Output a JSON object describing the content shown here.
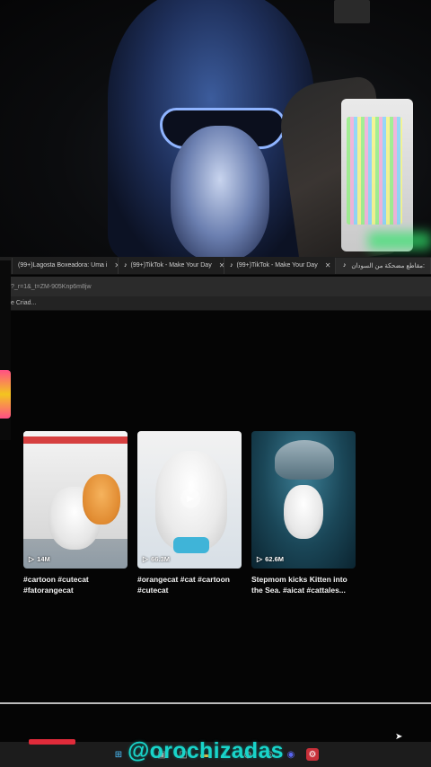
{
  "browser": {
    "tabs": [
      {
        "label": "(99+)Lagosta Boxeadora: Uma i",
        "icon": "tiktok-icon",
        "active": false
      },
      {
        "label": "(99+)TikTok - Make Your Day",
        "icon": "tiktok-icon",
        "active": false
      },
      {
        "label": "(99+)TikTok - Make Your Day",
        "icon": "tiktok-icon",
        "active": false
      },
      {
        "label": "مقاطع مضحكة من السودان:",
        "icon": "tiktok-icon",
        "active": true
      }
    ],
    "address": "?_r=1&_t=ZM-905Knp6m8jw",
    "bookmark": "e Criad..."
  },
  "videos": [
    {
      "views": "14M",
      "caption_line1": "#cartoon #cutecat",
      "caption_line2": "#fatorangecat"
    },
    {
      "views": "66.3M",
      "caption_line1": "#orangecat #cat #cartoon",
      "caption_line2": "#cutecat"
    },
    {
      "views": "62.6M",
      "caption_line1": "Stepmom kicks Kitten into",
      "caption_line2": "the Sea. #aicat #cattales..."
    }
  ],
  "watermark": "@orochizadas",
  "colors": {
    "accent": "#19d4c9",
    "background": "#050505",
    "record": "#e02b3a"
  }
}
